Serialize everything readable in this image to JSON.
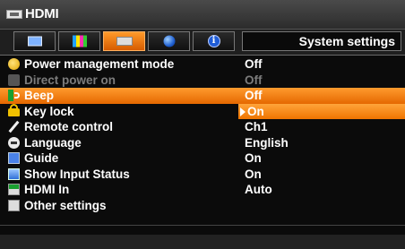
{
  "window": {
    "title": "HDMI",
    "source_icon": "hdmi-input-icon"
  },
  "tabs": [
    {
      "name": "image-adjustment",
      "icon": "screen-icon",
      "active": false
    },
    {
      "name": "color-adjustment",
      "icon": "color-bars-icon",
      "active": false
    },
    {
      "name": "input-settings",
      "icon": "input-connector-icon",
      "active": true
    },
    {
      "name": "network-settings",
      "icon": "globe-icon",
      "active": false
    },
    {
      "name": "information",
      "icon": "info-icon",
      "active": false
    }
  ],
  "current_tab_label": "System settings",
  "menu_items": [
    {
      "label": "Power management mode",
      "value": "Off",
      "icon": "power-icon",
      "state": "normal"
    },
    {
      "label": "Direct power on",
      "value": "Off",
      "icon": "direct-power-icon",
      "state": "disabled"
    },
    {
      "label": "Beep",
      "value": "Off",
      "icon": "speaker-icon",
      "state": "selected"
    },
    {
      "label": "Key lock",
      "value": "On",
      "icon": "lock-icon",
      "state": "value-highlighted"
    },
    {
      "label": "Remote control",
      "value": "Ch1",
      "icon": "remote-icon",
      "state": "normal"
    },
    {
      "label": "Language",
      "value": "English",
      "icon": "speech-bubble-icon",
      "state": "normal"
    },
    {
      "label": "Guide",
      "value": "On",
      "icon": "guide-icon",
      "state": "normal"
    },
    {
      "label": "Show Input Status",
      "value": "On",
      "icon": "input-status-icon",
      "state": "normal"
    },
    {
      "label": "HDMI In",
      "value": "Auto",
      "icon": "hdmi-in-icon",
      "state": "normal"
    },
    {
      "label": "Other settings",
      "value": "",
      "icon": "other-settings-icon",
      "state": "normal"
    }
  ],
  "colors": {
    "accent": "#f07a10",
    "disabled_text": "#7c7c7c",
    "background": "#0b0b0b"
  }
}
